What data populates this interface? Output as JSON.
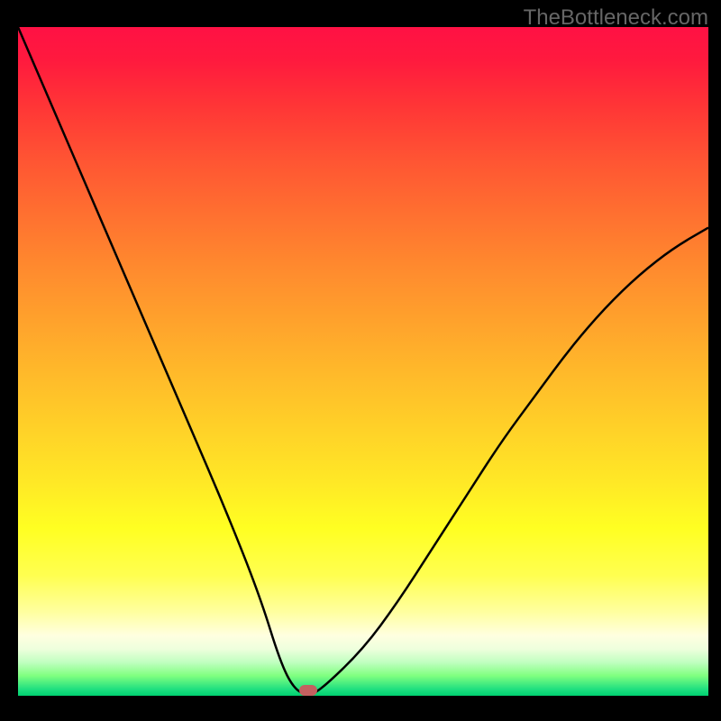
{
  "watermark": "TheBottleneck.com",
  "chart_data": {
    "type": "line",
    "title": "",
    "xlabel": "",
    "ylabel": "",
    "xlim": [
      0,
      100
    ],
    "ylim": [
      0,
      100
    ],
    "series": [
      {
        "name": "bottleneck-curve",
        "x": [
          0,
          5,
          10,
          15,
          20,
          25,
          30,
          35,
          38,
          40,
          42,
          44,
          50,
          55,
          60,
          65,
          70,
          75,
          80,
          85,
          90,
          95,
          100
        ],
        "values": [
          100,
          88,
          76,
          64,
          52,
          40,
          28,
          15,
          5,
          1,
          0,
          1,
          7,
          14,
          22,
          30,
          38,
          45,
          52,
          58,
          63,
          67,
          70
        ]
      }
    ],
    "marker": {
      "x": 42,
      "y": 0.8
    },
    "background_gradient": {
      "top": "#ff1144",
      "bottom": "#00d070"
    }
  }
}
